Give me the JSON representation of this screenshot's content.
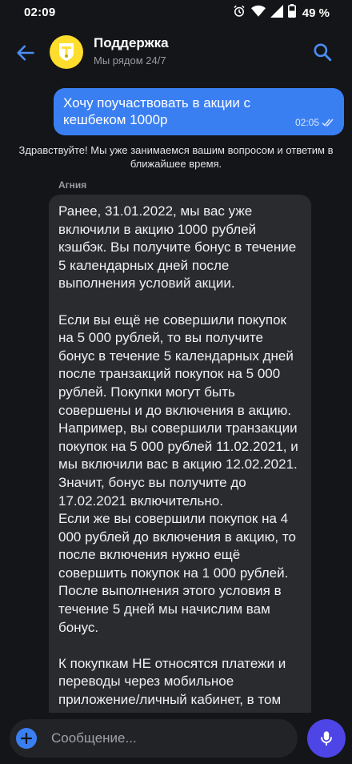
{
  "status_bar": {
    "time": "02:09",
    "battery": "49 %"
  },
  "header": {
    "title": "Поддержка",
    "subtitle": "Мы рядом 24/7",
    "avatar_color": "#ffdd2d"
  },
  "messages": {
    "outgoing": {
      "text": "Хочу поучаствовать в акции с кешбеком 1000р",
      "time": "02:05"
    },
    "system": "Здравствуйте! Мы уже занимаемся вашим вопросом и ответим в ближайшее время.",
    "incoming": {
      "sender": "Агния",
      "text": "Ранее, 31.01.2022, мы вас уже включили в акцию 1000 рублей кэшбэк. Вы получите бонус в течение 5 календарных дней после выполнения условий акции.\n\nЕсли вы ещё не совершили покупок на 5 000 рублей, то вы получите бонус в течение 5 календарных дней после транзакций покупок на 5 000 рублей. Покупки могут быть совершены и до включения в акцию.\nНапример, вы совершили транзакции покупок на 5 000 рублей 11.02.2021, и мы включили вас в акцию 12.02.2021. Значит, бонус вы получите до 17.02.2021 включительно.\nЕсли же вы совершили покупок на 4 000 рублей до включения в акцию, то после включения нужно ещё совершить покупок на 1 000 рублей. После выполнения этого условия в течение 5 дней мы начислим вам бонус.\n\nК покупкам НЕ относятся платежи и переводы через мобильное приложение/личный кабинет, в том"
    }
  },
  "composer": {
    "placeholder": "Сообщение..."
  },
  "colors": {
    "accent": "#3a7ff2",
    "mic_button": "#4d45e5",
    "background": "#141518",
    "incoming_bubble": "#2a2b2f"
  },
  "icons": {
    "back": "arrow-left-icon",
    "search": "search-icon",
    "attach": "plus-icon",
    "mic": "microphone-icon",
    "read": "double-check-icon"
  }
}
